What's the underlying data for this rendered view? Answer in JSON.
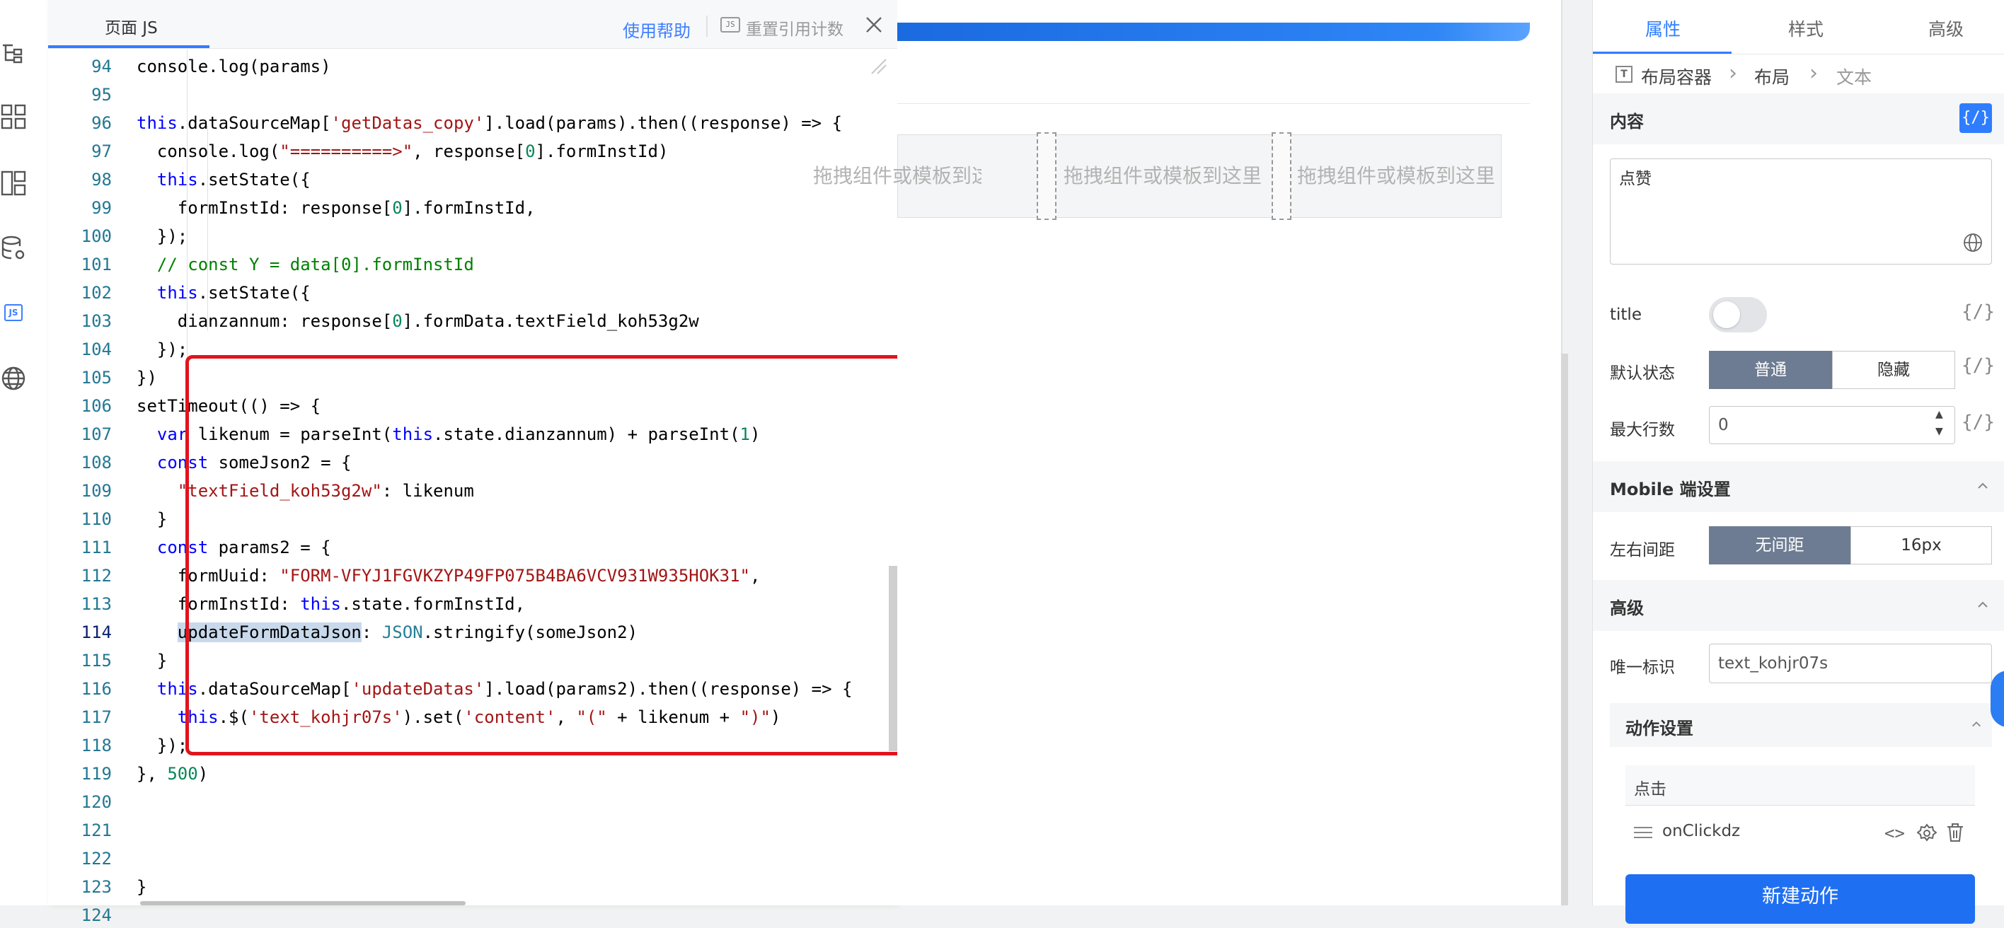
{
  "code_panel": {
    "tab": "页面 JS",
    "help": "使用帮助",
    "reset_icon_text": "JS",
    "reset": "重置引用计数",
    "lines": [
      {
        "n": "94",
        "t": "  console.log(params)"
      },
      {
        "n": "95",
        "t": ""
      },
      {
        "n": "96",
        "t": "  this.dataSourceMap['getDatas_copy'].load(params).then((response) => {"
      },
      {
        "n": "97",
        "t": "    console.log(\"==========>\", response[0].formInstId)"
      },
      {
        "n": "98",
        "t": "    this.setState({"
      },
      {
        "n": "99",
        "t": "      formInstId: response[0].formInstId,"
      },
      {
        "n": "100",
        "t": "    });"
      },
      {
        "n": "101",
        "t": "    // const Y = data[0].formInstId"
      },
      {
        "n": "102",
        "t": "    this.setState({"
      },
      {
        "n": "103",
        "t": "      dianzannum: response[0].formData.textField_koh53g2w"
      },
      {
        "n": "104",
        "t": "    });"
      },
      {
        "n": "105",
        "t": "  })"
      },
      {
        "n": "106",
        "t": "  setTimeout(() => {"
      },
      {
        "n": "107",
        "t": "    var likenum = parseInt(this.state.dianzannum) + parseInt(1)"
      },
      {
        "n": "108",
        "t": "    const someJson2 = {"
      },
      {
        "n": "109",
        "t": "      \"textField_koh53g2w\": likenum"
      },
      {
        "n": "110",
        "t": "    }"
      },
      {
        "n": "111",
        "t": "    const params2 = {"
      },
      {
        "n": "112",
        "t": "      formUuid: \"FORM-VFYJ1FGVKZYP49FP075B4BA6VCV931W935HOK31\","
      },
      {
        "n": "113",
        "t": "      formInstId: this.state.formInstId,"
      },
      {
        "n": "114",
        "t": "      updateFormDataJson: JSON.stringify(someJson2)"
      },
      {
        "n": "115",
        "t": "    }"
      },
      {
        "n": "116",
        "t": "    this.dataSourceMap['updateDatas'].load(params2).then((response) => {"
      },
      {
        "n": "117",
        "t": "      this.$('text_kohjr07s').set('content', \"(\" + likenum + \")\")"
      },
      {
        "n": "118",
        "t": "    });"
      },
      {
        "n": "119",
        "t": "  }, 500)"
      },
      {
        "n": "120",
        "t": ""
      },
      {
        "n": "121",
        "t": ""
      },
      {
        "n": "122",
        "t": ""
      },
      {
        "n": "123",
        "t": "}"
      },
      {
        "n": "124",
        "t": ""
      }
    ]
  },
  "canvas": {
    "slots": [
      "拖拽组件或模板到这里",
      "拖拽组件或模板到这里",
      "拖拽组件或模板到这里"
    ]
  },
  "props": {
    "tabs": [
      "属性",
      "样式",
      "高级"
    ],
    "breadcrumb": [
      "布局容器",
      "布局",
      "文本"
    ],
    "content_section": "内容",
    "expr_glyph": "{/}",
    "content_value": "点赞",
    "title_label": "title",
    "default_state_label": "默认状态",
    "default_state_options": [
      "普通",
      "隐藏"
    ],
    "max_rows_label": "最大行数",
    "max_rows_value": "0",
    "mobile_section": "Mobile 端设置",
    "margin_label": "左右间距",
    "margin_options": [
      "无间距",
      "16px"
    ],
    "advanced_section": "高级",
    "uid_label": "唯一标识",
    "uid_value": "text_kohjr07s",
    "action_section": "动作设置",
    "event_label": "点击",
    "handler": "onClickdz",
    "code_glyph": "<>",
    "new_action": "新建动作"
  },
  "colors": {
    "accent": "#2f7dff",
    "highlight_box": "#e1141e",
    "segment_active": "#6d7c92"
  },
  "icons": [
    "outline-tree-icon",
    "components-grid-icon",
    "layout-icon",
    "datasource-icon",
    "js-icon",
    "globe-icon",
    "close-icon",
    "gear-icon",
    "trash-icon",
    "drag-handle-icon",
    "chevron-up-icon"
  ]
}
